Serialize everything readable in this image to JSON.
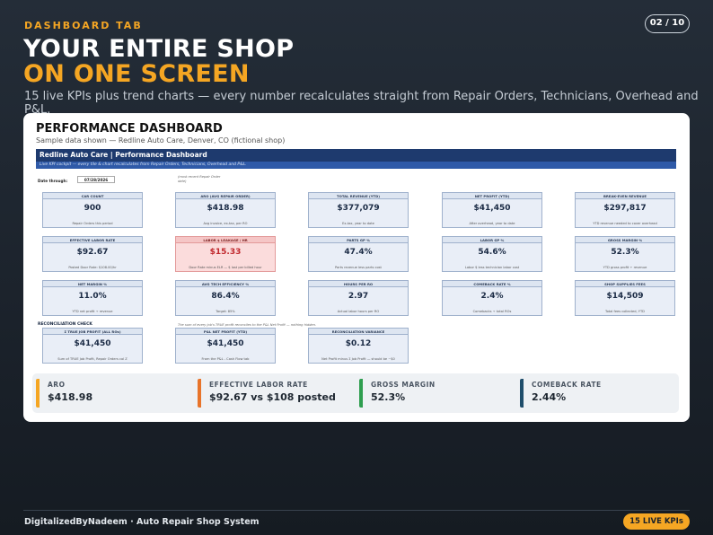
{
  "slide": {
    "tag": "DASHBOARD TAB",
    "pager": "02 / 10",
    "headline_1": "YOUR ENTIRE SHOP",
    "headline_2": "ON ONE SCREEN",
    "subtitle": "15 live KPIs plus trend charts — every number recalculates straight from Repair Orders, Technicians, Overhead and P&L."
  },
  "card": {
    "title": "PERFORMANCE DASHBOARD",
    "subtitle": "Sample data shown — Redline Auto Care, Denver, CO (fictional shop)"
  },
  "sheet": {
    "header": "Redline Auto Care  |  Performance Dashboard",
    "subheader": "Live KPI cockpit — every tile & chart recalculates from Repair Orders, Technicians, Overhead and P&L.",
    "date_label": "Date through:",
    "date_value": "07/28/2026",
    "date_note": "(most recent Repair Order date)",
    "kpis": [
      {
        "label": "CAR COUNT",
        "value": "900",
        "note": "Repair Orders this period"
      },
      {
        "label": "ARO (AVG REPAIR ORDER)",
        "value": "$418.98",
        "note": "Avg invoice, ex-tax, per RO"
      },
      {
        "label": "TOTAL REVENUE (YTD)",
        "value": "$377,079",
        "note": "Ex-tax, year to date"
      },
      {
        "label": "NET PROFIT (YTD)",
        "value": "$41,450",
        "note": "After overhead, year to date"
      },
      {
        "label": "BREAK-EVEN REVENUE",
        "value": "$297,817",
        "note": "YTD revenue needed to cover overhead"
      },
      {
        "label": "EFFECTIVE LABOR RATE",
        "value": "$92.67",
        "note": "Posted Door Rate: $108.00/hr"
      },
      {
        "label": "LABOR $ LEAKAGE / HR",
        "value": "$15.33",
        "note": "Door Rate minus ELR — $ lost per billed hour"
      },
      {
        "label": "PARTS GP %",
        "value": "47.4%",
        "note": "Parts revenue less parts cost"
      },
      {
        "label": "LABOR GP %",
        "value": "54.6%",
        "note": "Labor $ less technician labor cost"
      },
      {
        "label": "GROSS MARGIN %",
        "value": "52.3%",
        "note": "YTD gross profit ÷ revenue"
      },
      {
        "label": "NET MARGIN %",
        "value": "11.0%",
        "note": "YTD net profit ÷ revenue"
      },
      {
        "label": "AVG TECH EFFICIENCY %",
        "value": "86.4%",
        "note": "Target: 85%"
      },
      {
        "label": "HOURS PER RO",
        "value": "2.97",
        "note": "Actual labor hours per RO"
      },
      {
        "label": "COMEBACK RATE %",
        "value": "2.4%",
        "note": "Comebacks ÷ total ROs"
      },
      {
        "label": "SHOP SUPPLIES FEES",
        "value": "$14,509",
        "note": "Total fees collected, YTD"
      }
    ],
    "reconciliation_label": "RECONCILIATION CHECK",
    "reconciliation_note": "The sum of every job's TRUE profit reconciles to the P&L Net Profit — nothing hidden.",
    "reconciliation": [
      {
        "label": "Σ TRUE JOB PROFIT (ALL ROs)",
        "value": "$41,450",
        "note": "Sum of TRUE Job Profit, Repair Orders col Z"
      },
      {
        "label": "P&L NET PROFIT (YTD)",
        "value": "$41,450",
        "note": "From the P&L - Cash Flow tab"
      },
      {
        "label": "RECONCILIATION VARIANCE",
        "value": "$0.12",
        "note": "Net Profit minus Σ Job Profit — should be ~$0"
      }
    ]
  },
  "strip": [
    {
      "label": "ARO",
      "value": "$418.98",
      "color": "#f5a623"
    },
    {
      "label": "EFFECTIVE LABOR RATE",
      "value": "$92.67 vs $108 posted",
      "color": "#e8742a"
    },
    {
      "label": "GROSS MARGIN",
      "value": "52.3%",
      "color": "#2e9e4f"
    },
    {
      "label": "COMEBACK RATE",
      "value": "2.44%",
      "color": "#1f4e6b"
    }
  ],
  "footer": {
    "text": "DigitalizedByNadeem  ·  Auto Repair Shop System",
    "badge": "15 LIVE KPIs"
  }
}
